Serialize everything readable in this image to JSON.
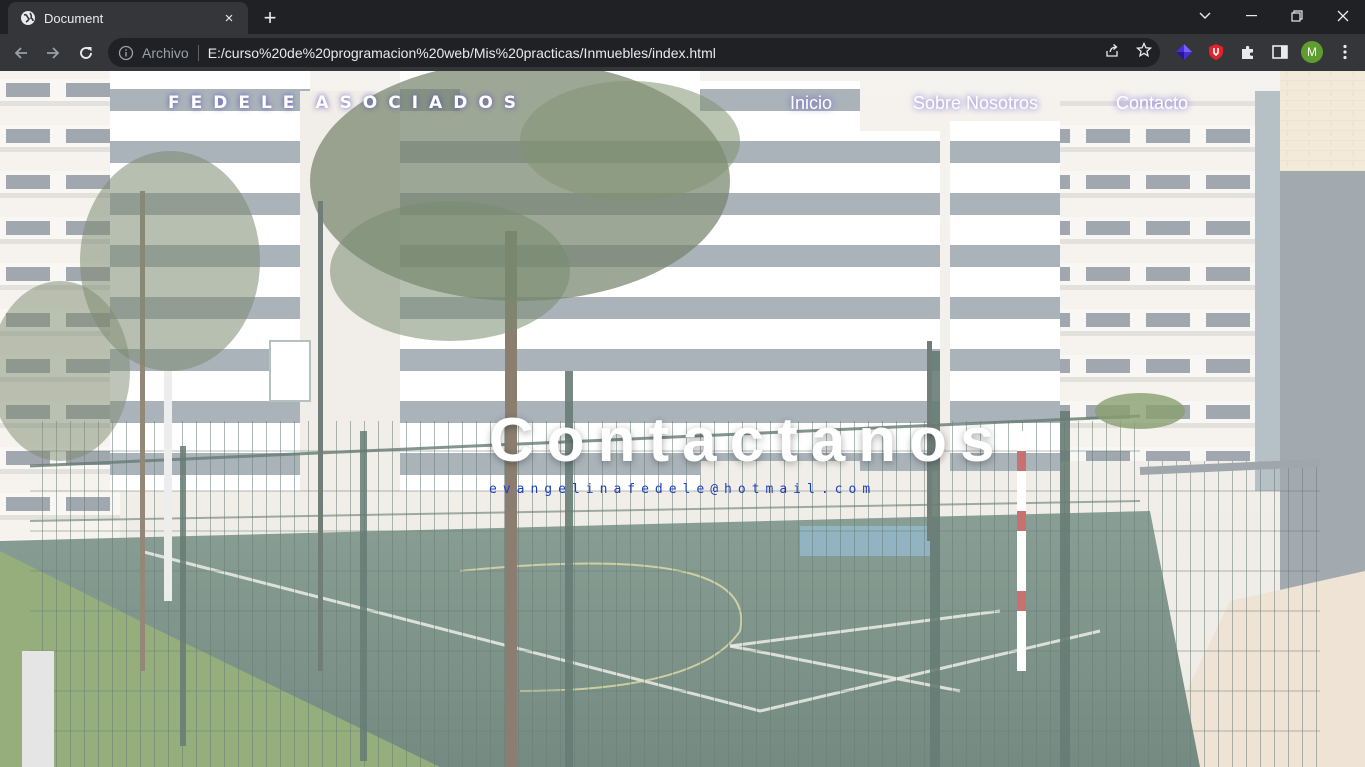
{
  "browser": {
    "tab": {
      "title": "Document",
      "close_glyph": "×"
    },
    "new_tab_glyph": "+",
    "omnibox": {
      "site_label": "Archivo",
      "url": "E:/curso%20de%20programacion%20web/Mis%20practicas/Inmuebles/index.html"
    },
    "profile_initial": "M",
    "icons": {
      "favicon": "globe-icon",
      "back": "arrow-left-icon",
      "forward": "arrow-right-icon",
      "reload": "reload-icon",
      "info": "info-icon",
      "share": "share-icon",
      "bookmark": "star-icon",
      "extensions": [
        "purple-gem-extension-icon",
        "red-shield-extension-icon",
        "puzzle-extensions-icon"
      ],
      "side_panel": "side-panel-icon",
      "menu": "kebab-menu-icon",
      "window": [
        "chevron-down-icon",
        "minimize-icon",
        "restore-icon",
        "close-icon"
      ]
    },
    "colors": {
      "tabbar_bg": "#202124",
      "toolbar_bg": "#35363a",
      "avatar_bg": "#5e9e2f"
    }
  },
  "page": {
    "brand": {
      "part1": "FEDELE",
      "part2": "ASOCIADOS"
    },
    "nav": [
      "Inicio",
      "Sobre Nosotros",
      "Contacto"
    ],
    "hero": {
      "title": "Contactanos",
      "email": "evangelinafedele@hotmail.com"
    },
    "colors": {
      "nav_glow": "#5a46c8",
      "email_text": "#1f3fbf",
      "title_text": "#ffffff"
    }
  }
}
